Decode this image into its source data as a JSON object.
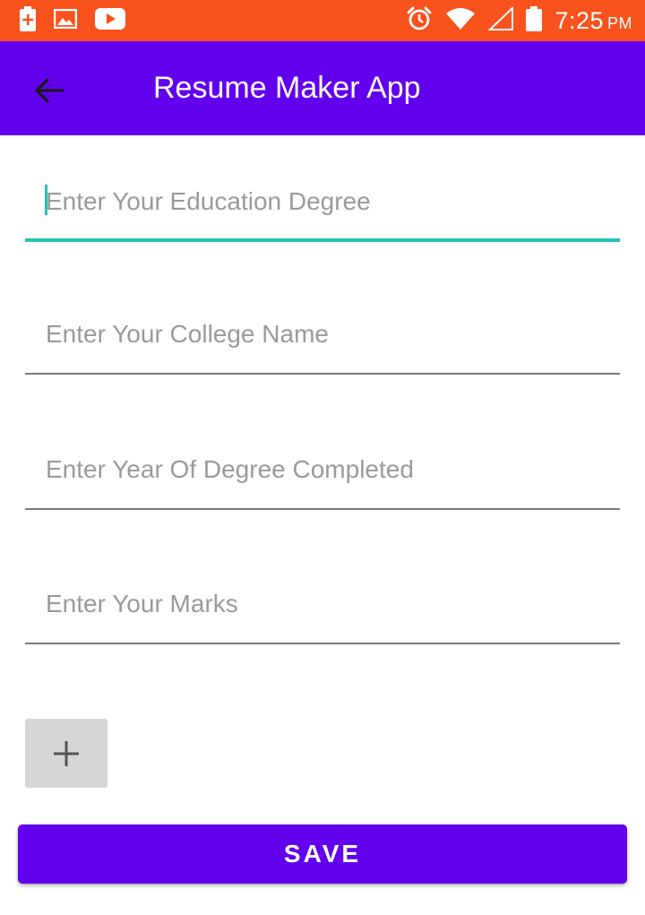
{
  "status_bar": {
    "time": "7:25",
    "ampm": "PM",
    "color": "#f9521d",
    "left_icons": [
      "battery-saver-icon",
      "gallery-notification-icon",
      "youtube-notification-icon"
    ],
    "right_icons": [
      "alarm-icon",
      "wifi-icon",
      "cellular-signal-icon",
      "battery-icon"
    ]
  },
  "app_bar": {
    "title": "Resume Maker App",
    "color": "#6200ee",
    "back_icon": "arrow-back-icon"
  },
  "form": {
    "fields": [
      {
        "placeholder": "Enter Your Education Degree",
        "value": "",
        "focused": true
      },
      {
        "placeholder": "Enter Your College Name",
        "value": "",
        "focused": false
      },
      {
        "placeholder": "Enter Year Of Degree Completed",
        "value": "",
        "focused": false
      },
      {
        "placeholder": "Enter Your Marks",
        "value": "",
        "focused": false
      }
    ],
    "focus_color": "#22c4b6",
    "add_icon": "plus-icon"
  },
  "save_button": {
    "label": "SAVE",
    "color": "#6200ee"
  }
}
